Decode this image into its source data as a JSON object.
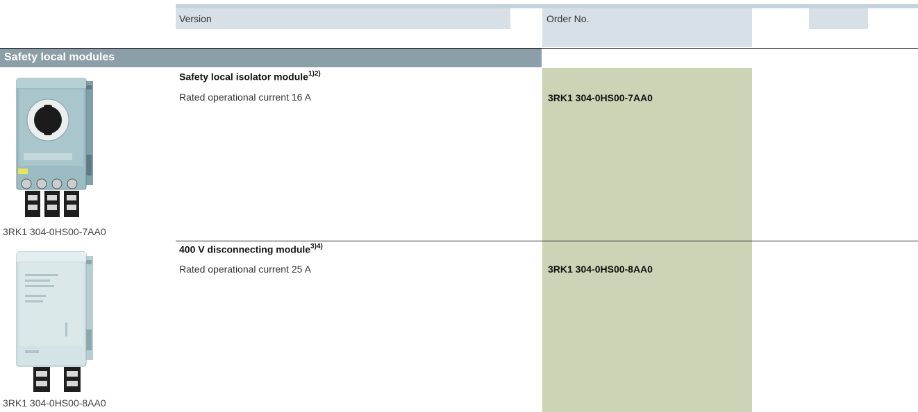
{
  "header": {
    "version_label": "Version",
    "order_label": "Order No."
  },
  "section": {
    "title": "Safety local modules"
  },
  "products": [
    {
      "title": "Safety local isolator module",
      "title_footnote": "1)2)",
      "description": "Rated operational current 16 A",
      "order_no": "3RK1 304-0HS00-7AA0",
      "image_caption": "3RK1 304-0HS00-7AA0",
      "image_icon": "isolator-module-with-rotary-switch"
    },
    {
      "title": "400 V disconnecting module",
      "title_footnote": "3)4)",
      "description": "Rated operational current 25 A",
      "order_no": "3RK1 304-0HS00-8AA0",
      "image_caption": "3RK1 304-0HS00-8AA0",
      "image_icon": "disconnecting-module"
    }
  ],
  "colors": {
    "header_band": "#d7e0e6",
    "section_bar": "#8c9ea8",
    "order_column": "#cbd5b6"
  }
}
